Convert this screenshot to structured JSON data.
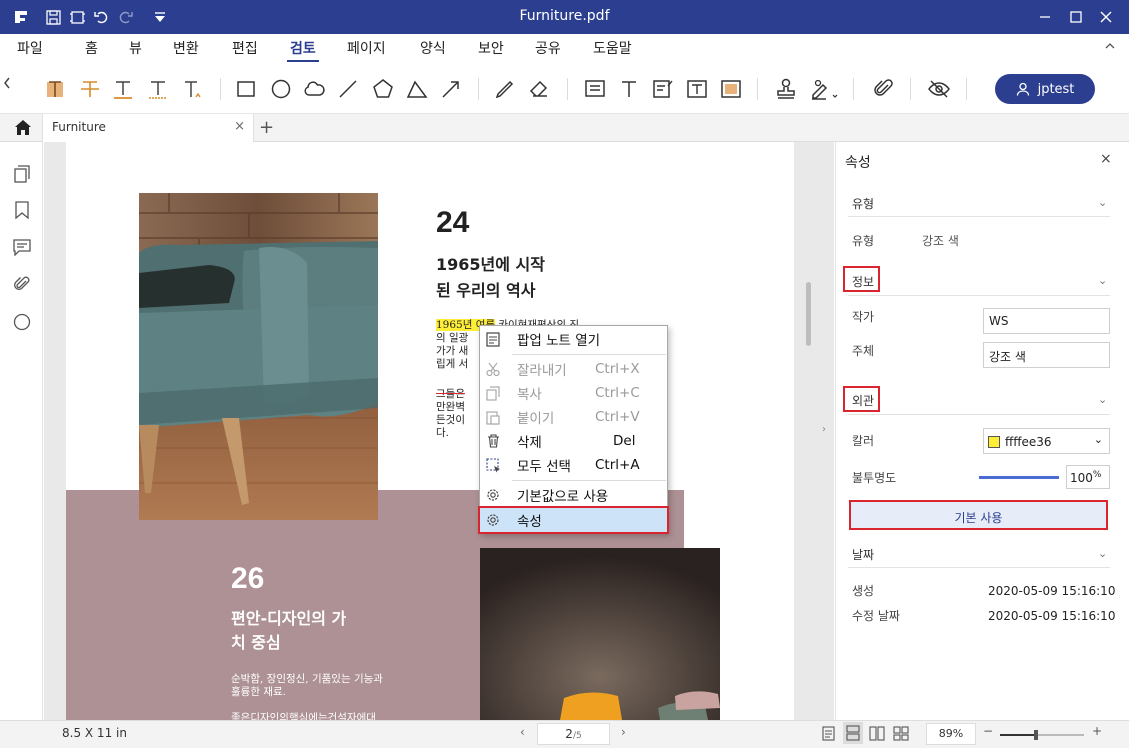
{
  "titlebar": {
    "title": "Furniture.pdf",
    "color": "#2c3e8f"
  },
  "menu": [
    {
      "label": "파일"
    },
    {
      "label": "홈"
    },
    {
      "label": "뷰"
    },
    {
      "label": "변환"
    },
    {
      "label": "편집"
    },
    {
      "label": "검토"
    },
    {
      "label": "페이지"
    },
    {
      "label": "양식"
    },
    {
      "label": "보안"
    },
    {
      "label": "공유"
    },
    {
      "label": "도움말"
    }
  ],
  "user": {
    "name": "jptest"
  },
  "tab": {
    "label": "Furniture"
  },
  "doc": {
    "section1": {
      "number": "24",
      "heading_line1": "1965년에 시작",
      "heading_line2": "된 우리의 역사",
      "highlight": "1965년 여름",
      "text_line1": " 카이현재편산의 진",
      "text_line2": "의 일광",
      "text_line3": "가가 새",
      "text_line4": "립게 서",
      "text_line5": "그들은",
      "text_line6": "만완벽",
      "text_line7": "든것이",
      "text_line8": "다."
    },
    "section2": {
      "number": "26",
      "heading_line1": "편안-디자인의 가",
      "heading_line2": "치 중심",
      "text_line1": "순박함, 장인정신, 기품있는 기능과",
      "text_line2": "훌륭한 재료.",
      "text_line3": "좋은디자인의핵심에는건설자에대"
    }
  },
  "context_menu": {
    "open_note": "팝업 노트 열기",
    "cut": "잘라내기",
    "cut_key": "Ctrl+X",
    "copy": "복사",
    "copy_key": "Ctrl+C",
    "paste": "붙이기",
    "paste_key": "Ctrl+V",
    "delete": "삭제",
    "delete_key": "Del",
    "select_all": "모두 선택",
    "select_all_key": "Ctrl+A",
    "set_default": "기본값으로 사용",
    "properties": "속성"
  },
  "properties": {
    "title": "속성",
    "type_section": "유형",
    "type_label": "유형",
    "type_value": "강조 색",
    "info_section": "정보",
    "author_label": "작가",
    "author_value": "WS",
    "subject_label": "주체",
    "subject_value": "강조 색",
    "appearance_section": "외관",
    "color_label": "칼러",
    "color_value": "ffffee36",
    "color_swatch": "#ffee36",
    "opacity_label": "불투명도",
    "opacity_value": "100",
    "opacity_unit": "%",
    "opacity_fraction": 1.0,
    "default_button": "기본 사용",
    "date_section": "날짜",
    "created_label": "생성",
    "created_value": "2020-05-09 15:16:10",
    "modified_label": "수정 날짜",
    "modified_value": "2020-05-09 15:16:10"
  },
  "status": {
    "page_size": "8.5 X 11 in",
    "page_current": "2",
    "page_total": "/5",
    "zoom": "89%"
  },
  "colors": {
    "accent": "#2c3e8f",
    "highlight": "#ffee36",
    "red_outline": "#d9262e",
    "band": "#ad9194"
  }
}
